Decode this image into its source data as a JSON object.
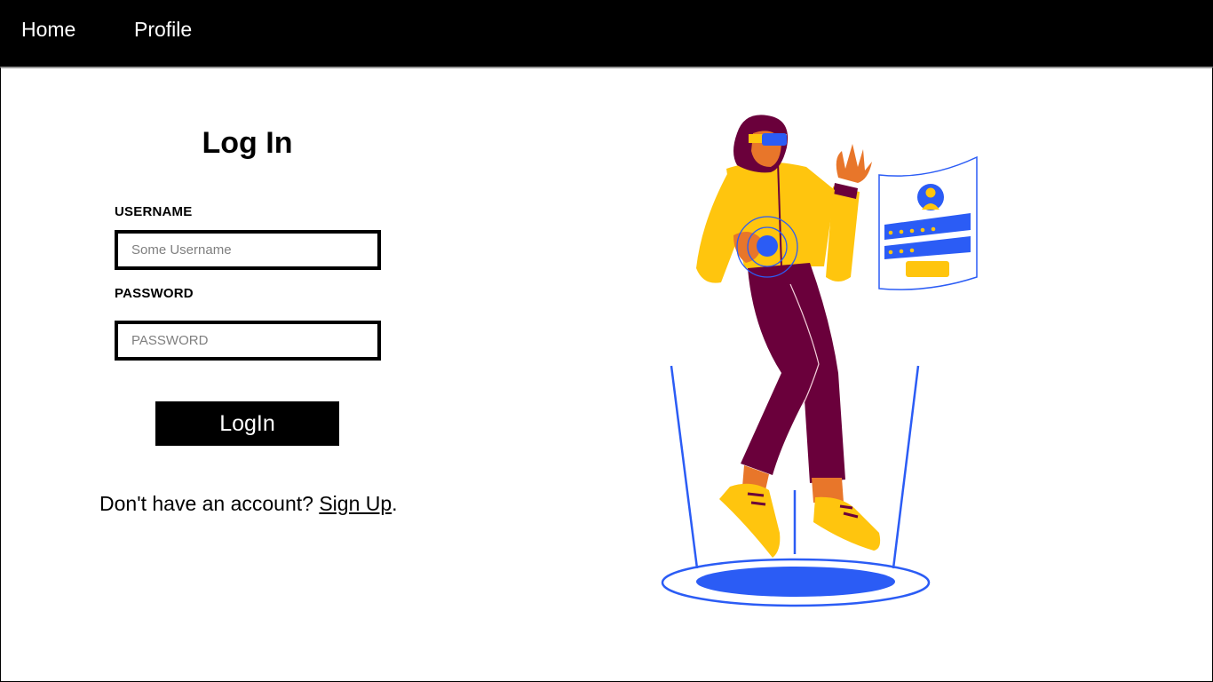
{
  "nav": {
    "home_label": "Home",
    "profile_label": "Profile"
  },
  "form": {
    "title": "Log In",
    "username_label": "USERNAME",
    "username_placeholder": "Some Username",
    "password_label": "PASSWORD",
    "password_placeholder": "PASSWORD",
    "submit_label": "LogIn",
    "signup_prompt": "Don't have an account?",
    "signup_link": "Sign Up",
    "signup_suffix": "."
  },
  "illustration": {
    "subject": "woman-vr-login-illustration",
    "colors": {
      "yellow": "#FFC50E",
      "maroon": "#6A003B",
      "blue": "#2B5CF5",
      "skin": "#E8762A"
    }
  }
}
